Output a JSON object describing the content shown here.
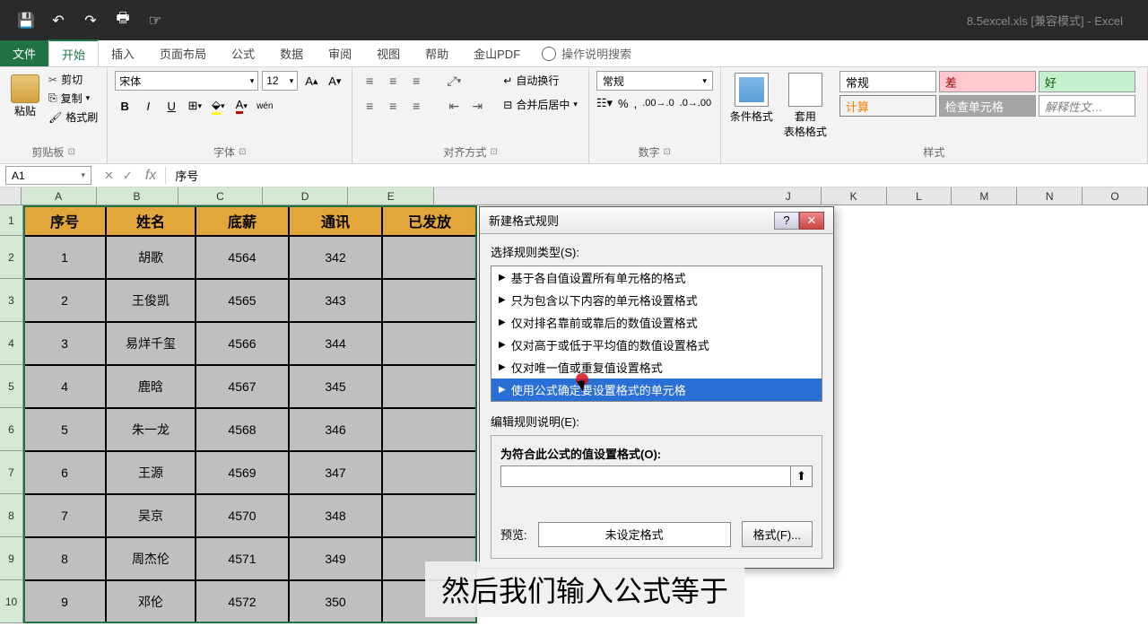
{
  "app": {
    "title": "8.5excel.xls  [兼容模式]  -  Excel"
  },
  "qat": {
    "save": "save",
    "undo": "undo",
    "redo": "redo",
    "touch": "touch"
  },
  "tabs": {
    "file": "文件",
    "home": "开始",
    "insert": "插入",
    "layout": "页面布局",
    "formulas": "公式",
    "data": "数据",
    "review": "审阅",
    "view": "视图",
    "help": "帮助",
    "pdf": "金山PDF",
    "tellme": "操作说明搜索"
  },
  "ribbon": {
    "clipboard": {
      "paste": "粘贴",
      "cut": "剪切",
      "copy": "复制",
      "painter": "格式刷",
      "label": "剪贴板"
    },
    "font": {
      "name": "宋体",
      "size": "12",
      "label": "字体",
      "bold": "B",
      "italic": "I",
      "underline": "U",
      "wen": "wén"
    },
    "align": {
      "wrap": "自动换行",
      "merge": "合并后居中",
      "label": "对齐方式"
    },
    "number": {
      "format": "常规",
      "percent": "%",
      "comma": ",",
      "label": "数字"
    },
    "styles": {
      "cond": "条件格式",
      "table": "套用\n表格格式",
      "normal": "常规",
      "bad": "差",
      "good": "好",
      "calc": "计算",
      "check": "检查单元格",
      "explain": "解释性文…",
      "label": "样式"
    }
  },
  "namebox": "A1",
  "formula": "序号",
  "columns": [
    "A",
    "B",
    "C",
    "D",
    "E",
    "J",
    "K",
    "L",
    "M",
    "N",
    "O"
  ],
  "col_widths": {
    "A": 92,
    "B": 100,
    "C": 104,
    "D": 104,
    "E": 106,
    "rest": 80
  },
  "row_heights": {
    "header": 34,
    "data": 48
  },
  "table": {
    "headers": [
      "序号",
      "姓名",
      "底薪",
      "通讯",
      "已发放"
    ],
    "rows": [
      [
        "1",
        "胡歌",
        "4564",
        "342",
        ""
      ],
      [
        "2",
        "王俊凯",
        "4565",
        "343",
        ""
      ],
      [
        "3",
        "易烊千玺",
        "4566",
        "344",
        ""
      ],
      [
        "4",
        "鹿晗",
        "4567",
        "345",
        ""
      ],
      [
        "5",
        "朱一龙",
        "4568",
        "346",
        ""
      ],
      [
        "6",
        "王源",
        "4569",
        "347",
        ""
      ],
      [
        "7",
        "吴京",
        "4570",
        "348",
        ""
      ],
      [
        "8",
        "周杰伦",
        "4571",
        "349",
        ""
      ],
      [
        "9",
        "邓伦",
        "4572",
        "350",
        ""
      ]
    ]
  },
  "dialog": {
    "title": "新建格式规则",
    "select_label": "选择规则类型(S):",
    "rules": [
      "基于各自值设置所有单元格的格式",
      "只为包含以下内容的单元格设置格式",
      "仅对排名靠前或靠后的数值设置格式",
      "仅对高于或低于平均值的数值设置格式",
      "仅对唯一值或重复值设置格式",
      "使用公式确定要设置格式的单元格"
    ],
    "selected_index": 5,
    "edit_label": "编辑规则说明(E):",
    "formula_label": "为符合此公式的值设置格式(O):",
    "formula_value": "",
    "preview_label": "预览:",
    "preview_text": "未设定格式",
    "format_btn": "格式(F)..."
  },
  "caption": "然后我们输入公式等于"
}
